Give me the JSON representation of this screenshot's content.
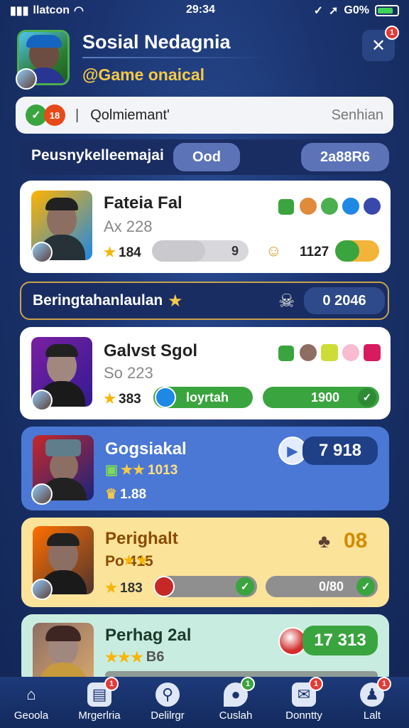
{
  "status_bar": {
    "carrier": "llatcon",
    "time": "29:34",
    "battery": "G0%",
    "battery_level": 0.8
  },
  "header": {
    "title": "Sosial Nedagnia",
    "subtitle": "@Game onaical",
    "menu_badge": "1"
  },
  "search": {
    "value": "Qolmiemant'",
    "right_label": "Senhian",
    "chip_check": "✓",
    "chip_count": "18"
  },
  "filter": {
    "label": "Peusnykelleemajai",
    "pill_left": "Ood",
    "pill_right": "2a88R6"
  },
  "cards": [
    {
      "name": "Fateia Fal",
      "sub": "Ax 228",
      "stat_value": "184",
      "bar_value": "9",
      "right_value": "1127",
      "bar_fill": 0.55,
      "right_fill": 0.55
    },
    {
      "name": "Galvst Sgol",
      "sub": "So 223",
      "stat_value": "383",
      "button_label": "loyrtah",
      "right_value": "1900"
    },
    {
      "name": "Gogsiakal",
      "sub": "1013",
      "stat_value": "1.88",
      "right_value": "7 918"
    },
    {
      "name": "Perighalt",
      "sub": "Po 415",
      "stat_value": "183",
      "right_value": "08",
      "bar_value": "0/80"
    },
    {
      "name": "Perhag 2al",
      "sub": "B6",
      "right_value": "17 313"
    }
  ],
  "banner": {
    "label": "Beringtahanlaulan",
    "value": "0  2046"
  },
  "nav": [
    {
      "label": "Geoola",
      "icon": "home-icon",
      "badge": ""
    },
    {
      "label": "Mrgerlria",
      "icon": "chat-icon",
      "badge": "1"
    },
    {
      "label": "Delilrgr",
      "icon": "search-icon",
      "badge": ""
    },
    {
      "label": "Cuslah",
      "icon": "location-icon",
      "badge": "1"
    },
    {
      "label": "Donntty",
      "icon": "mail-icon",
      "badge": "1"
    },
    {
      "label": "Lalt",
      "icon": "profile-icon",
      "badge": "1"
    }
  ],
  "colors": {
    "accent_gold": "#f7c948",
    "card_blue": "#4a78d4",
    "card_yellow": "#fbe39a",
    "card_mint": "#c9ece0",
    "green": "#3aa43f"
  }
}
